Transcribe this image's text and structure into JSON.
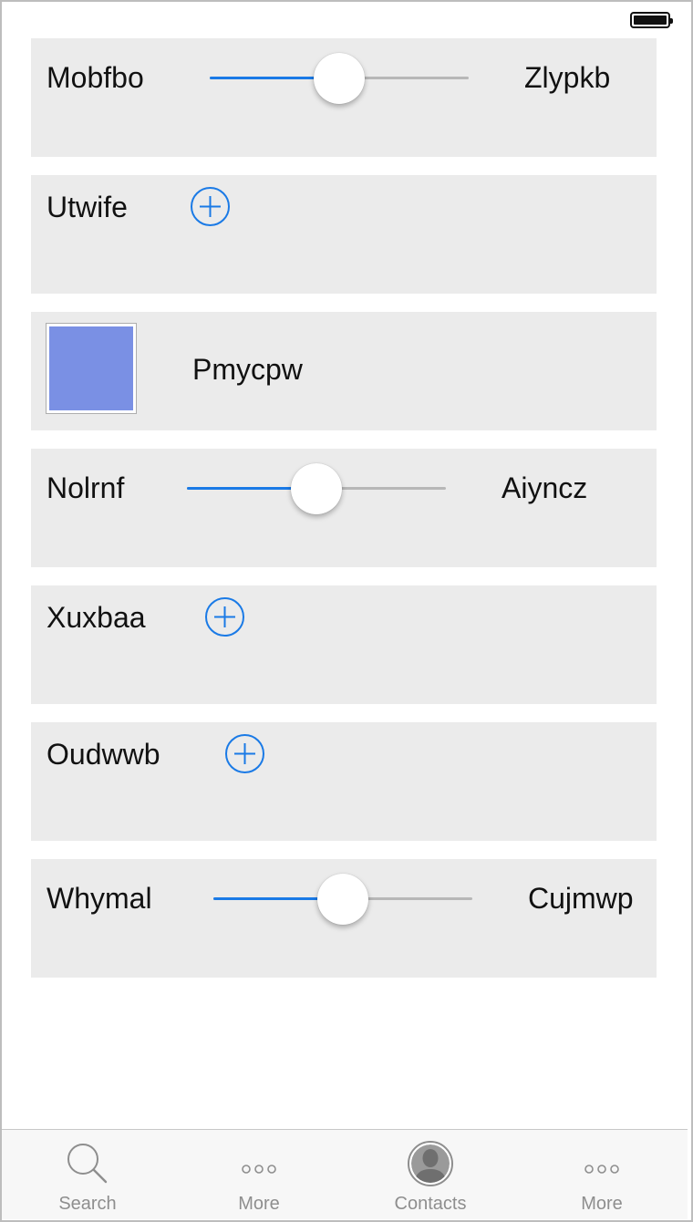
{
  "status_bar": {
    "battery_icon": "battery-full-icon"
  },
  "accent_color": "#1a7ae6",
  "rows": [
    {
      "type": "slider",
      "left_label": "Mobfbo",
      "right_label": "Zlypkb",
      "value_fraction": 0.5
    },
    {
      "type": "stepper",
      "label": "Utwife",
      "icon": "plus-circle-icon"
    },
    {
      "type": "color",
      "label": "Pmycpw",
      "color": "#7a90e4"
    },
    {
      "type": "slider",
      "left_label": "Nolrnf",
      "right_label": "Aiyncz",
      "value_fraction": 0.5
    },
    {
      "type": "stepper",
      "label": "Xuxbaa",
      "icon": "plus-circle-icon"
    },
    {
      "type": "stepper",
      "label": "Oudwwb",
      "icon": "plus-circle-icon"
    },
    {
      "type": "slider",
      "left_label": "Whymal",
      "right_label": "Cujmwp",
      "value_fraction": 0.5
    }
  ],
  "tab_bar": {
    "items": [
      {
        "label": "Search",
        "icon": "search-icon"
      },
      {
        "label": "More",
        "icon": "more-dots-icon"
      },
      {
        "label": "Contacts",
        "icon": "contacts-icon"
      },
      {
        "label": "More",
        "icon": "more-dots-icon"
      }
    ]
  }
}
